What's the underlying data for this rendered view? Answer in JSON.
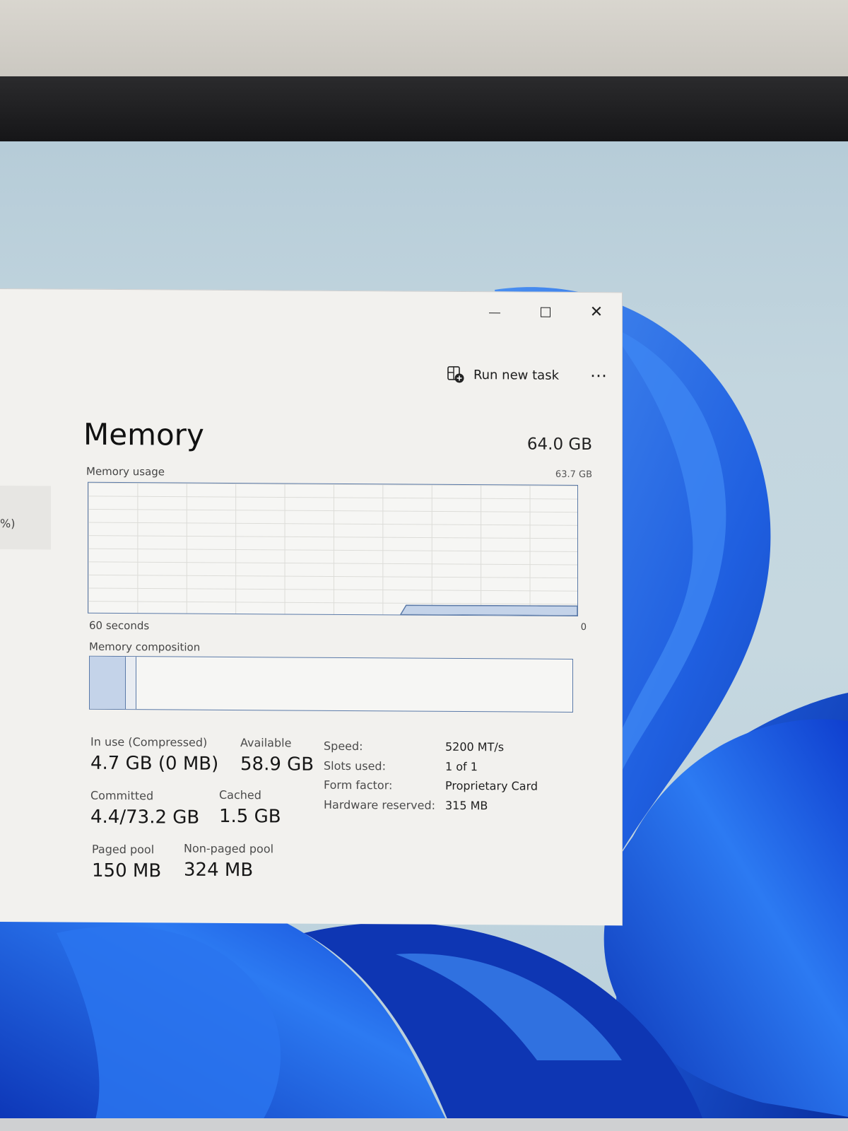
{
  "window": {
    "controls": {
      "minimize_icon": "minimize-icon",
      "maximize_icon": "maximize-icon",
      "close_icon": "close-icon",
      "close_glyph": "✕"
    },
    "left_panel_fragment": "%)"
  },
  "toolbar": {
    "run_new_task_label": "Run new task",
    "run_new_task_icon": "run-task-icon",
    "more_label": "⋯"
  },
  "memory": {
    "title": "Memory",
    "total": "64.0 GB",
    "usage_label": "Memory usage",
    "usage_max": "63.7 GB",
    "axis_left": "60 seconds",
    "axis_right": "0",
    "composition_label": "Memory composition",
    "stats": {
      "in_use": {
        "label": "In use (Compressed)",
        "value": "4.7 GB (0 MB)"
      },
      "available": {
        "label": "Available",
        "value": "58.9 GB"
      },
      "committed": {
        "label": "Committed",
        "value": "4.4/73.2 GB"
      },
      "cached": {
        "label": "Cached",
        "value": "1.5 GB"
      },
      "paged_pool": {
        "label": "Paged pool",
        "value": "150 MB"
      },
      "non_paged_pool": {
        "label": "Non-paged pool",
        "value": "324 MB"
      }
    },
    "specs": [
      {
        "key": "Speed:",
        "value": "5200 MT/s"
      },
      {
        "key": "Slots used:",
        "value": "1 of 1"
      },
      {
        "key": "Form factor:",
        "value": "Proprietary Card"
      },
      {
        "key": "Hardware reserved:",
        "value": "315 MB"
      }
    ]
  },
  "chart_data": {
    "type": "area",
    "title": "Memory usage",
    "xlabel": "",
    "ylabel": "",
    "x_range": [
      60,
      0
    ],
    "y_range": [
      0,
      63.7
    ],
    "x": [
      60,
      48,
      30,
      22,
      21,
      15,
      10,
      5,
      0
    ],
    "values": [
      null,
      null,
      null,
      null,
      4.6,
      4.6,
      4.7,
      4.7,
      4.7
    ],
    "composition": {
      "in_use_gb": 4.7,
      "modified_gb": 0.4,
      "standby_gb": 1.5,
      "free_gb": 57.4,
      "total_gb": 64.0
    },
    "colors": {
      "line": "#5b7aa8",
      "fill": "#c4d3e9"
    }
  }
}
